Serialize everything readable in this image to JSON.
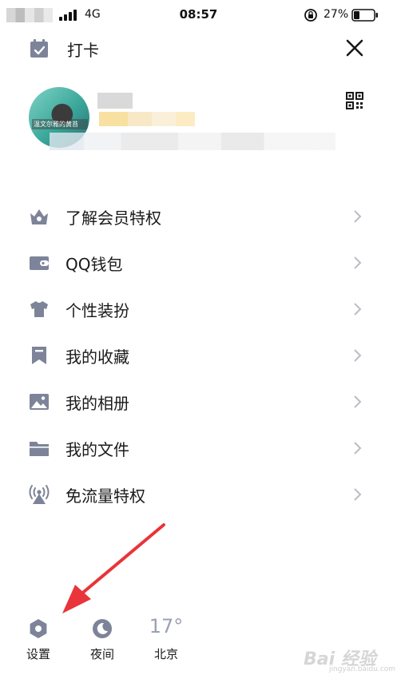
{
  "colors": {
    "icon": "#7d8499",
    "text": "#1a1a1a",
    "chevron": "#b9bdc6",
    "arrow": "#e8343a",
    "temperature": "#9aa1b3"
  },
  "status_bar": {
    "network": "4G",
    "time": "08:57",
    "battery": "27%"
  },
  "header": {
    "checkin_label": "打卡",
    "checkin_icon": "calendar-check-icon",
    "close_icon": "close-icon",
    "qr_icon": "qr-code-icon"
  },
  "profile": {
    "avatar_caption": "温文尔雅的黄苔"
  },
  "menu": [
    {
      "label": "了解会员特权",
      "icon": "vip-crown-icon"
    },
    {
      "label": "QQ钱包",
      "icon": "wallet-icon"
    },
    {
      "label": "个性装扮",
      "icon": "shirt-icon"
    },
    {
      "label": "我的收藏",
      "icon": "bookmark-icon"
    },
    {
      "label": "我的相册",
      "icon": "photo-icon"
    },
    {
      "label": "我的文件",
      "icon": "folder-icon"
    },
    {
      "label": "免流量特权",
      "icon": "signal-tower-icon"
    }
  ],
  "bottom_bar": {
    "settings_label": "设置",
    "night_label": "夜间",
    "temperature": "17°",
    "city": "北京"
  },
  "watermark": {
    "text": "Bai 经验",
    "sub": "jingyan.baidu.com"
  }
}
